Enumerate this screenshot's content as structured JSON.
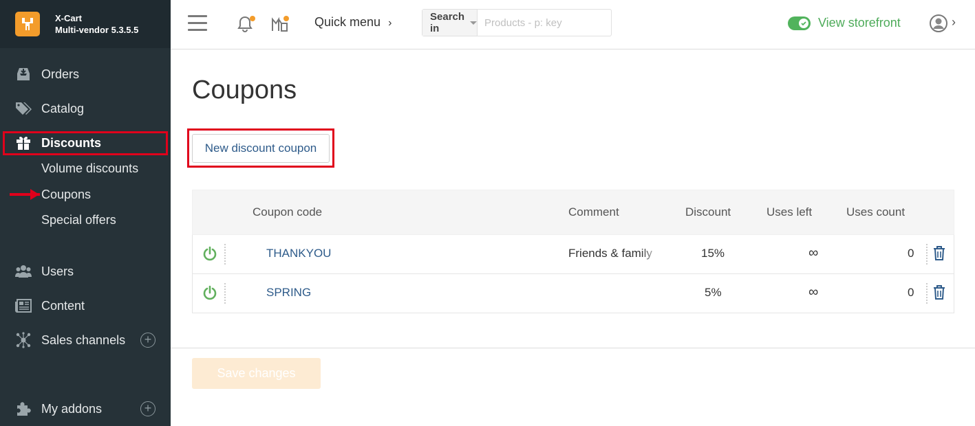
{
  "brand": {
    "name": "X-Cart",
    "edition": "Multi-vendor 5.3.5.5"
  },
  "sidebar": {
    "items": [
      {
        "label": "Orders",
        "icon": "inbox-icon"
      },
      {
        "label": "Catalog",
        "icon": "tags-icon"
      },
      {
        "label": "Discounts",
        "icon": "gift-icon",
        "active": true
      },
      {
        "label": "Users",
        "icon": "users-icon"
      },
      {
        "label": "Content",
        "icon": "newspaper-icon"
      },
      {
        "label": "Sales channels",
        "icon": "network-icon"
      },
      {
        "label": "My addons",
        "icon": "puzzle-icon"
      }
    ],
    "discount_subitems": [
      "Volume discounts",
      "Coupons",
      "Special offers"
    ]
  },
  "topbar": {
    "quick_menu": "Quick menu",
    "search_in_label": "Search in",
    "search_placeholder": "Products - p: key",
    "storefront_label": "View storefront"
  },
  "page": {
    "title": "Coupons",
    "new_button": "New discount coupon",
    "save_button": "Save changes"
  },
  "table": {
    "headers": [
      "Coupon code",
      "Comment",
      "Discount",
      "Uses left",
      "Uses count"
    ],
    "rows": [
      {
        "code": "THANKYOU",
        "comment": "Friends & family",
        "discount": "15%",
        "uses_left": "∞",
        "uses_count": "0",
        "enabled": true
      },
      {
        "code": "SPRING",
        "comment": "",
        "discount": "5%",
        "uses_left": "∞",
        "uses_count": "0",
        "enabled": true
      }
    ]
  },
  "colors": {
    "sidebar_bg": "#263238",
    "brand_accent": "#f39c2b",
    "link_blue": "#2e5b8a",
    "storefront_green": "#4eab5a",
    "highlight_red": "#e0001b"
  }
}
